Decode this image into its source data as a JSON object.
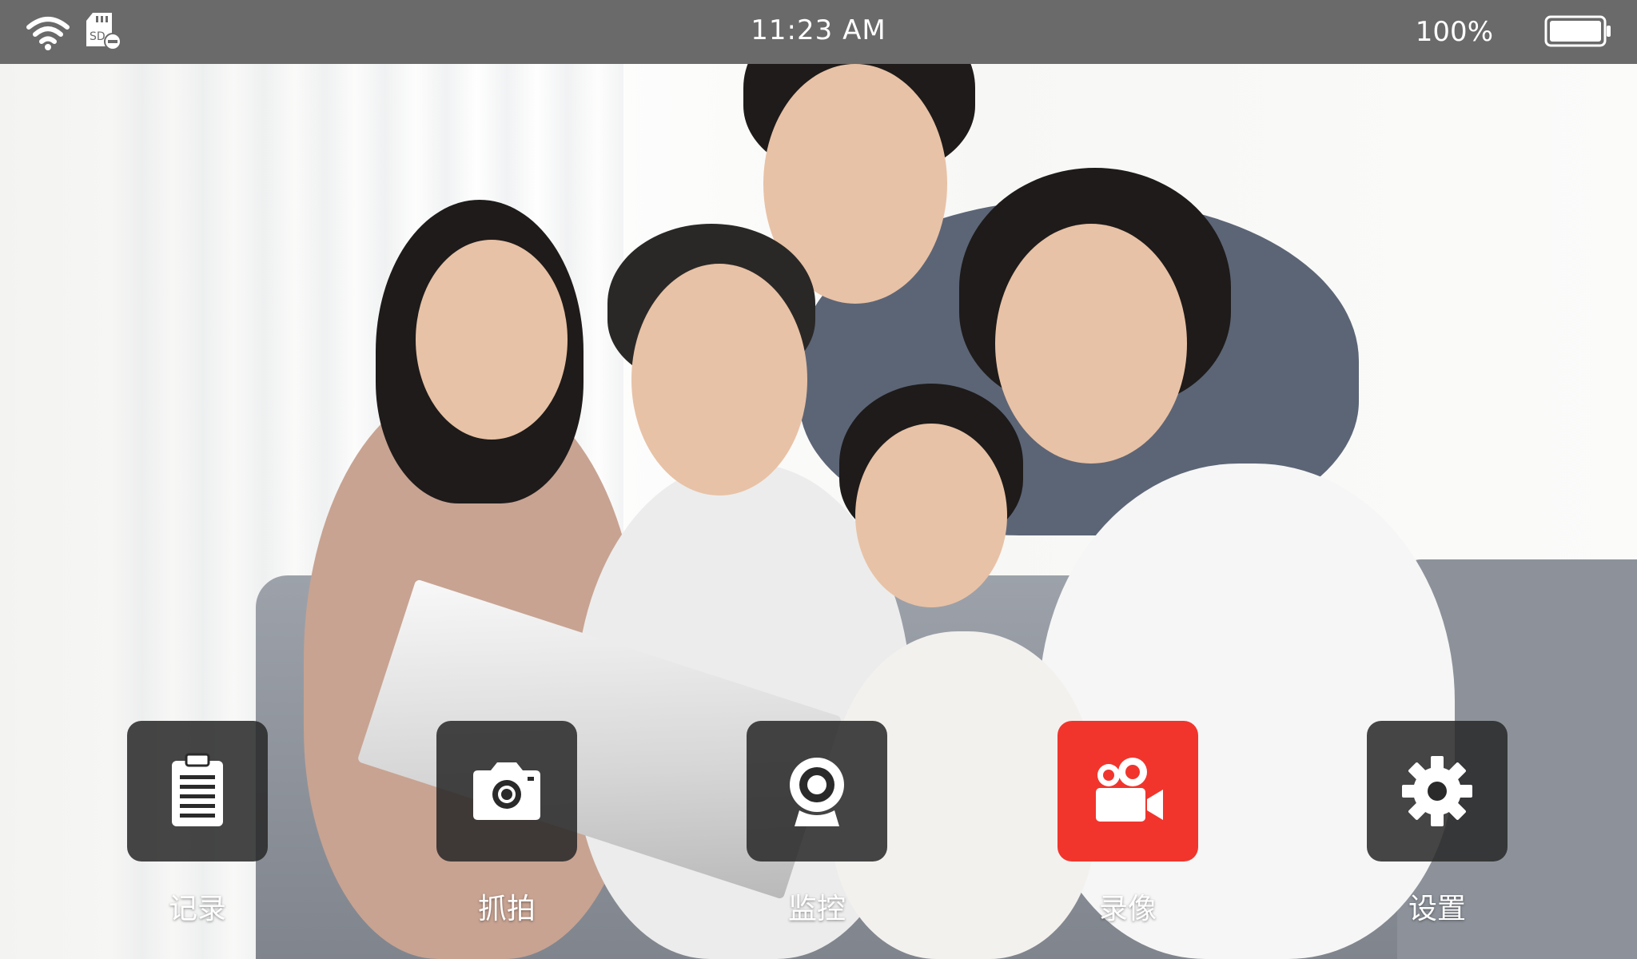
{
  "status_bar": {
    "time": "11:23 AM",
    "battery_percent": "100%",
    "battery_level": 1.0,
    "icons": [
      "wifi-icon",
      "sd-card-icon",
      "battery-icon"
    ]
  },
  "dock": {
    "items": [
      {
        "label": "记录",
        "icon": "clipboard-icon",
        "active": false
      },
      {
        "label": "抓拍",
        "icon": "camera-icon",
        "active": false
      },
      {
        "label": "监控",
        "icon": "webcam-icon",
        "active": false
      },
      {
        "label": "录像",
        "icon": "video-camera-icon",
        "active": true
      },
      {
        "label": "设置",
        "icon": "gear-icon",
        "active": false
      }
    ]
  },
  "colors": {
    "status_bar": "#6a6a6a",
    "button": "#2a2a2a",
    "active_button": "#f1352d",
    "icon": "#ffffff"
  }
}
